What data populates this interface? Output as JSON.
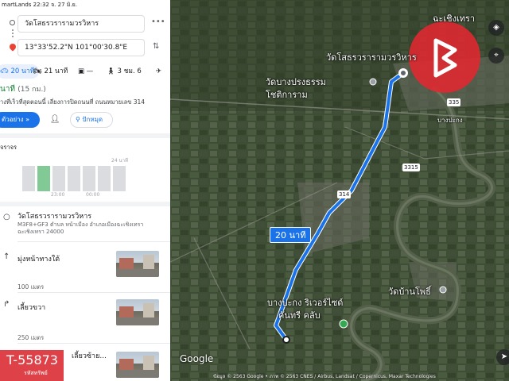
{
  "statusbar": {
    "text": "martLands  22:32  จ. 27 มิ.ย."
  },
  "directions": {
    "origin": "วัดโสธรวรารามวรวิหาร",
    "destination": "13°33'52.2\"N 101°00'30.8\"E",
    "more_icon": "more-vert-icon",
    "swap_icon": "swap-icon"
  },
  "modes": {
    "car": "20 นาที",
    "motorbike": "21 นาที",
    "transit": "—",
    "walk": "3 ชม. 6",
    "flight": ""
  },
  "route": {
    "eta": "นาที",
    "distance": "(15 กม.)",
    "note": "างที่เร็วที่สุดตอนนี้ เลี่ยงการปิดถนนที่ ถนนหมายเลข 314",
    "preview_label": "ตัวอย่าง",
    "pin_label": "ปักหมุด"
  },
  "traffic": {
    "label": "จราจร",
    "current_index": 1,
    "levels": [
      0.85,
      0.85,
      0.85,
      0.85,
      0.85,
      0.85,
      0.85
    ],
    "ticks": [
      "24 นาที",
      "23:00",
      "00:00"
    ]
  },
  "steps": [
    {
      "title": "วัดโสธรวรารามวรวิหาร",
      "sub1": "M3F8+GF3 ตำบล หน้าเมือง อำเภอเมืองฉะเชิงเทรา",
      "sub2": "ฉะเชิงเทรา 24000"
    },
    {
      "title": "มุ่งหน้าทางใต้",
      "distance": "100 เมตร"
    },
    {
      "title": "เลี้ยวขวา",
      "distance": "250 เมตร"
    },
    {
      "title": "เลี้ยวซ้าย..."
    }
  ],
  "watermark": {
    "code": "T-55873",
    "sub": "รหัสทรัพย์"
  },
  "map": {
    "labels": {
      "chachoengsao": "ฉะเชิงเทรา",
      "wat_sothon": "วัดโสธรวรารามวรวิหาร",
      "wat_bang_plong1": "วัดบางปรงธรรม",
      "wat_bang_plong2": "โชติการาม",
      "wat_ban_pho": "วัดบ้านโพธิ์",
      "bang_pakong1": "บางปะกง ริเวอร์ไซด์",
      "bang_pakong2": "คันทรี คลับ",
      "bang_pakong_river": "บางปะกง"
    },
    "road_314": "314",
    "road_3315": "3315",
    "road_335": "335",
    "time_pill": "20 นาที",
    "google": "Google",
    "attribution": "ข้อมูล © 2563 Google • ภาพ © 2563 CNES / Airbus, Landsat / Copernicus, Maxar Technologies"
  },
  "colors": {
    "route": "#1a73e8",
    "brand": "#db3137",
    "green_eta": "#188038"
  }
}
